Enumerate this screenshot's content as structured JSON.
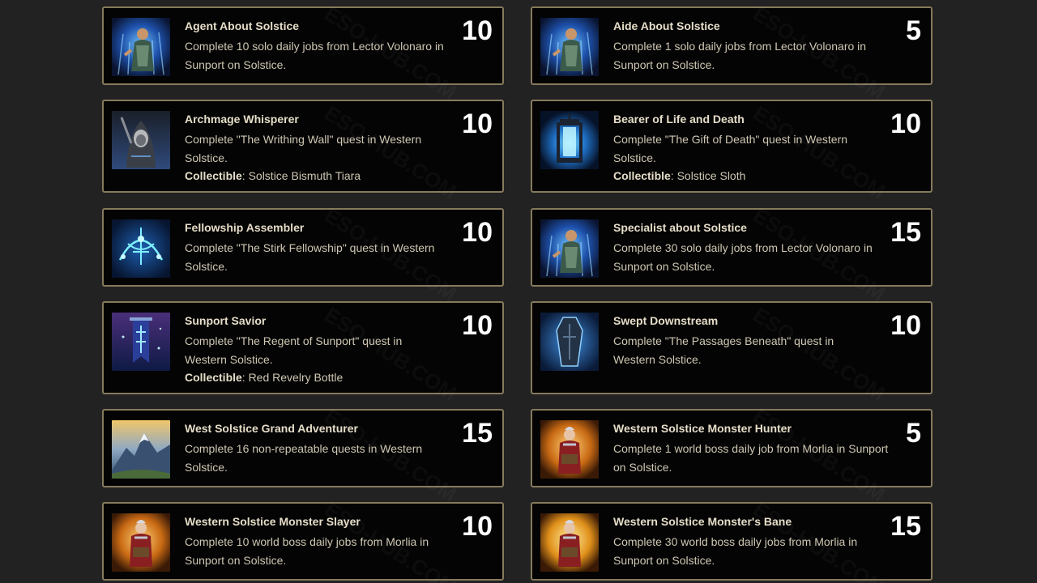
{
  "watermark": "ESO-HUB.COM",
  "colors": {
    "page_background": "#222222",
    "card_background": "#040404",
    "card_border": "#857a5c",
    "title_text": "#e6ddc8",
    "description_text": "#cfc7b3",
    "points_text": "#ffffff"
  },
  "achievements": [
    {
      "title": "Agent About Solstice",
      "description": "Complete 10 solo daily jobs from Lector Volonaro in Sunport on Solstice.",
      "points": "10",
      "icon": "figure-blue-aura-icon"
    },
    {
      "title": "Aide About Solstice",
      "description": "Complete 1 solo daily jobs from Lector Volonaro in Sunport on Solstice.",
      "points": "5",
      "icon": "figure-blue-aura-icon"
    },
    {
      "title": "Archmage Whisperer",
      "description": "Complete \"The Writhing Wall\" quest in Western Solstice.",
      "collectible_label": "Collectible",
      "collectible_value": ": Solstice Bismuth Tiara",
      "points": "10",
      "icon": "hooded-mage-icon"
    },
    {
      "title": "Bearer of Life and Death",
      "description": "Complete \"The Gift of Death\" quest in Western Solstice.",
      "collectible_label": "Collectible",
      "collectible_value": ": Solstice Sloth",
      "points": "10",
      "icon": "blue-lantern-icon"
    },
    {
      "title": "Fellowship Assembler",
      "description": "Complete \"The Stirk Fellowship\" quest in Western Solstice.",
      "points": "10",
      "icon": "arcane-sigil-icon"
    },
    {
      "title": "Specialist about Solstice",
      "description": "Complete 30 solo daily jobs from Lector Volonaro in Sunport on Solstice.",
      "points": "15",
      "icon": "figure-blue-aura-icon"
    },
    {
      "title": "Sunport Savior",
      "description": "Complete \"The Regent of Sunport\" quest in Western Solstice.",
      "collectible_label": "Collectible",
      "collectible_value": ": Red Revelry Bottle",
      "points": "10",
      "icon": "glowing-banner-icon"
    },
    {
      "title": "Swept Downstream",
      "description": "Complete \"The Passages Beneath\" quest in Western Solstice.",
      "points": "10",
      "icon": "coffin-icon"
    },
    {
      "title": "West Solstice Grand Adventurer",
      "description": "Complete 16 non-repeatable quests in Western Solstice.",
      "points": "15",
      "icon": "mountain-landscape-icon"
    },
    {
      "title": "Western Solstice Monster Hunter",
      "description": "Complete 1 world boss daily job from Morlia in Sunport on Solstice.",
      "points": "5",
      "icon": "warrior-with-book-icon"
    },
    {
      "title": "Western Solstice Monster Slayer",
      "description": "Complete 10 world boss daily jobs from Morlia in Sunport on Solstice.",
      "points": "10",
      "icon": "warrior-with-book-icon"
    },
    {
      "title": "Western Solstice Monster's Bane",
      "description": "Complete 30 world boss daily jobs from Morlia in Sunport on Solstice.",
      "points": "15",
      "icon": "warrior-with-book-icon"
    }
  ]
}
